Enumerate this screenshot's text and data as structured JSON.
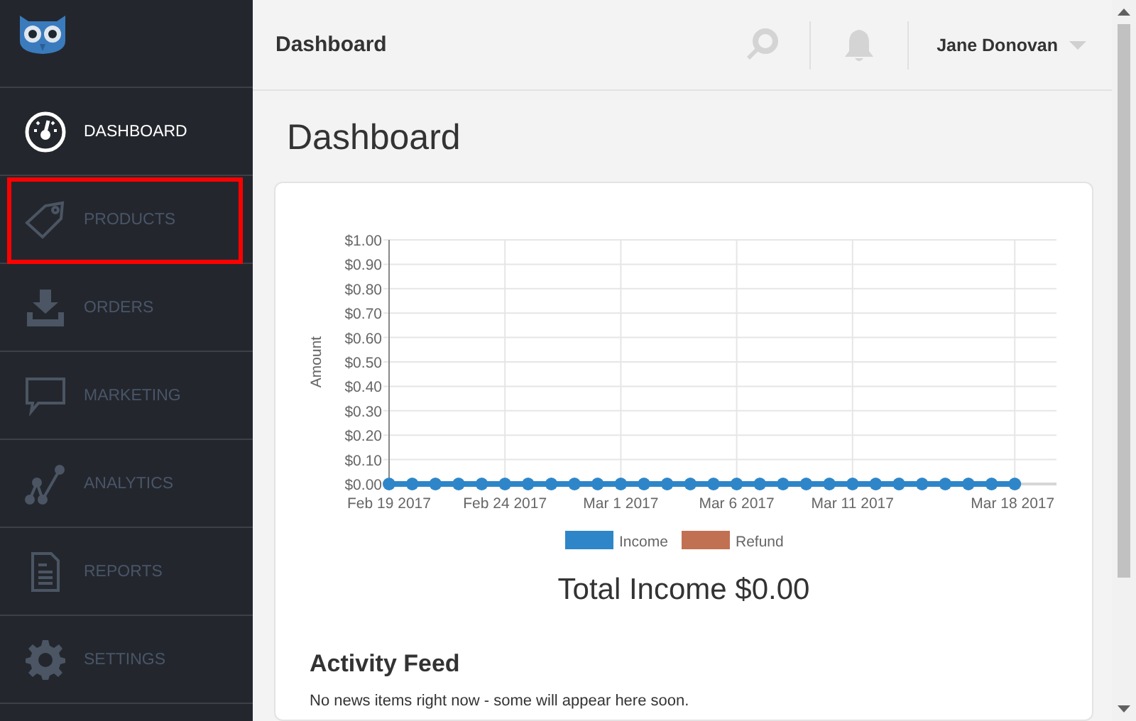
{
  "sidebar": {
    "items": [
      {
        "label": "DASHBOARD",
        "selected": true,
        "highlighted": false
      },
      {
        "label": "PRODUCTS",
        "selected": false,
        "highlighted": true
      },
      {
        "label": "ORDERS",
        "selected": false,
        "highlighted": false
      },
      {
        "label": "MARKETING",
        "selected": false,
        "highlighted": false
      },
      {
        "label": "ANALYTICS",
        "selected": false,
        "highlighted": false
      },
      {
        "label": "REPORTS",
        "selected": false,
        "highlighted": false
      },
      {
        "label": "SETTINGS",
        "selected": false,
        "highlighted": false
      }
    ]
  },
  "header": {
    "title": "Dashboard",
    "user": "Jane Donovan"
  },
  "page_title": "Dashboard",
  "chart_data": {
    "type": "line",
    "ylabel": "Amount",
    "categories": [
      "Feb 19 2017",
      null,
      null,
      null,
      null,
      "Feb 24 2017",
      null,
      null,
      null,
      null,
      "Mar 1 2017",
      null,
      null,
      null,
      null,
      "Mar 6 2017",
      null,
      null,
      null,
      null,
      "Mar 11 2017",
      null,
      null,
      null,
      null,
      null,
      null,
      "Mar 18 2017"
    ],
    "series": [
      {
        "name": "Income",
        "color": "#2e86c8",
        "marker": "circle",
        "values": [
          0,
          0,
          0,
          0,
          0,
          0,
          0,
          0,
          0,
          0,
          0,
          0,
          0,
          0,
          0,
          0,
          0,
          0,
          0,
          0,
          0,
          0,
          0,
          0,
          0,
          0,
          0,
          0
        ]
      },
      {
        "name": "Refund",
        "color": "#c27052",
        "values": [
          null,
          null,
          null,
          null,
          null,
          null,
          null,
          null,
          null,
          null,
          null,
          null,
          null,
          null,
          null,
          null,
          null,
          null,
          null,
          null,
          null,
          null,
          null,
          null,
          null,
          null,
          null,
          null
        ]
      }
    ],
    "grid": true,
    "legend": "bottom",
    "ylim": [
      0,
      1
    ],
    "yticks": [
      {
        "value": 0,
        "label": "$0.00"
      },
      {
        "value": 0.1,
        "label": "$0.10"
      },
      {
        "value": 0.2,
        "label": "$0.20"
      },
      {
        "value": 0.3,
        "label": "$0.30"
      },
      {
        "value": 0.4,
        "label": "$0.40"
      },
      {
        "value": 0.5,
        "label": "$0.50"
      },
      {
        "value": 0.6,
        "label": "$0.60"
      },
      {
        "value": 0.7,
        "label": "$0.70"
      },
      {
        "value": 0.8,
        "label": "$0.80"
      },
      {
        "value": 0.9,
        "label": "$0.90"
      },
      {
        "value": 1,
        "label": "$1.00"
      }
    ]
  },
  "total_income": "Total Income $0.00",
  "activity_feed": {
    "title": "Activity Feed",
    "message": "No news items right now - some will appear here soon."
  }
}
